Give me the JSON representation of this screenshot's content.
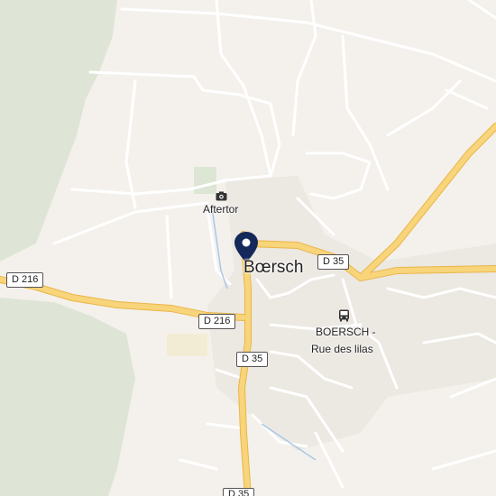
{
  "map": {
    "town_label": "Bœrsch",
    "poi_label": "Aftertor",
    "poi_icon": "camera-icon",
    "bus_stop_icon": "bus-icon",
    "bus_stop_line1": "BOERSCH -",
    "bus_stop_line2": "Rue des lilas",
    "marker_icon": "location-pin-icon",
    "roads": {
      "west": "D 216",
      "center": "D 216",
      "east": "D 35",
      "south": "D 35",
      "bottom": "D 35"
    },
    "colors": {
      "land": "#f4f1ec",
      "forest": "#dfe5d6",
      "major_road": "#f6cf6f",
      "minor_road": "#ffffff",
      "marker": "#14285a"
    }
  }
}
